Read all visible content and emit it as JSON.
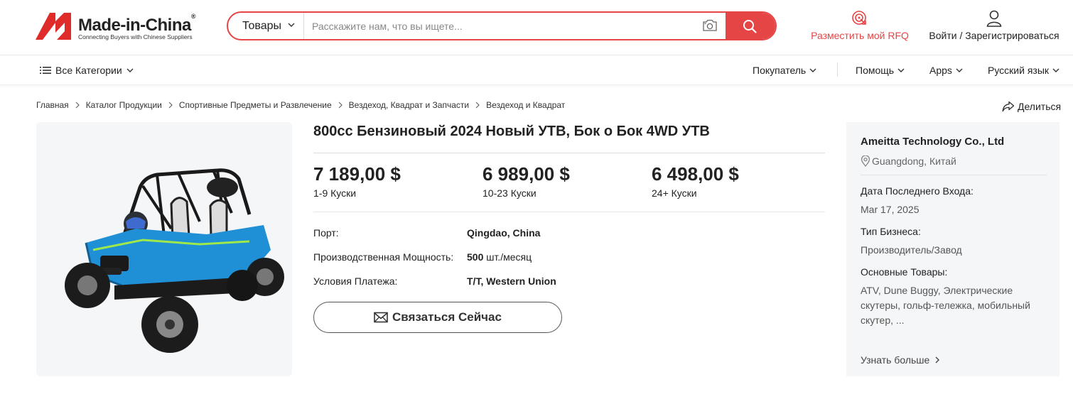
{
  "header": {
    "logo_text": "Made-in-China",
    "logo_reg": "®",
    "logo_tagline": "Connecting Buyers with Chinese Suppliers",
    "search": {
      "category": "Товары",
      "placeholder": "Расскажите нам, что вы ищете..."
    },
    "rfq_label": "Разместить мой RFQ",
    "login_label": "Войти / Зарегистрироваться",
    "brand_color": "#e64545"
  },
  "nav": {
    "categories": "Все Категории",
    "buyer": "Покупатель",
    "help": "Помощь",
    "apps": "Apps",
    "language": "Русский язык"
  },
  "breadcrumb": [
    "Главная",
    "Каталог Продукции",
    "Спортивные Предметы и Развлечение",
    "Вездеход, Квадрат и Запчасти",
    "Вездеход и Квадрат"
  ],
  "share_label": "Делиться",
  "product": {
    "title": "800cc Бензиновый 2024 Новый УТВ, Бок о Бок 4WD УТВ",
    "prices": [
      {
        "value": "7 189,00 $",
        "qty": "1-9 Куски"
      },
      {
        "value": "6 989,00 $",
        "qty": "10-23 Куски"
      },
      {
        "value": "6 498,00 $",
        "qty": "24+ Куски"
      }
    ],
    "attributes": {
      "port_label": "Порт:",
      "port_value": "Qingdao, China",
      "capacity_label": "Производственная Мощность:",
      "capacity_num": "500",
      "capacity_unit": " шт./месяц",
      "payment_label": "Условия Платежа:",
      "payment_value": "T/T, Western Union"
    },
    "contact_button": "Связаться Сейчас"
  },
  "supplier": {
    "name": "Ameitta Technology Co., Ltd",
    "location": "Guangdong, Китай",
    "last_login_label": "Дата Последнего Входа:",
    "last_login_value": "Mar 17, 2025",
    "business_type_label": "Тип Бизнеса:",
    "business_type_value": "Производитель/Завод",
    "main_products_label": "Основные Товары:",
    "main_products_value": "ATV, Dune Buggy, Электрические скутеры, гольф-тележка, мобильный скутер, ...",
    "learn_more": "Узнать больше"
  }
}
